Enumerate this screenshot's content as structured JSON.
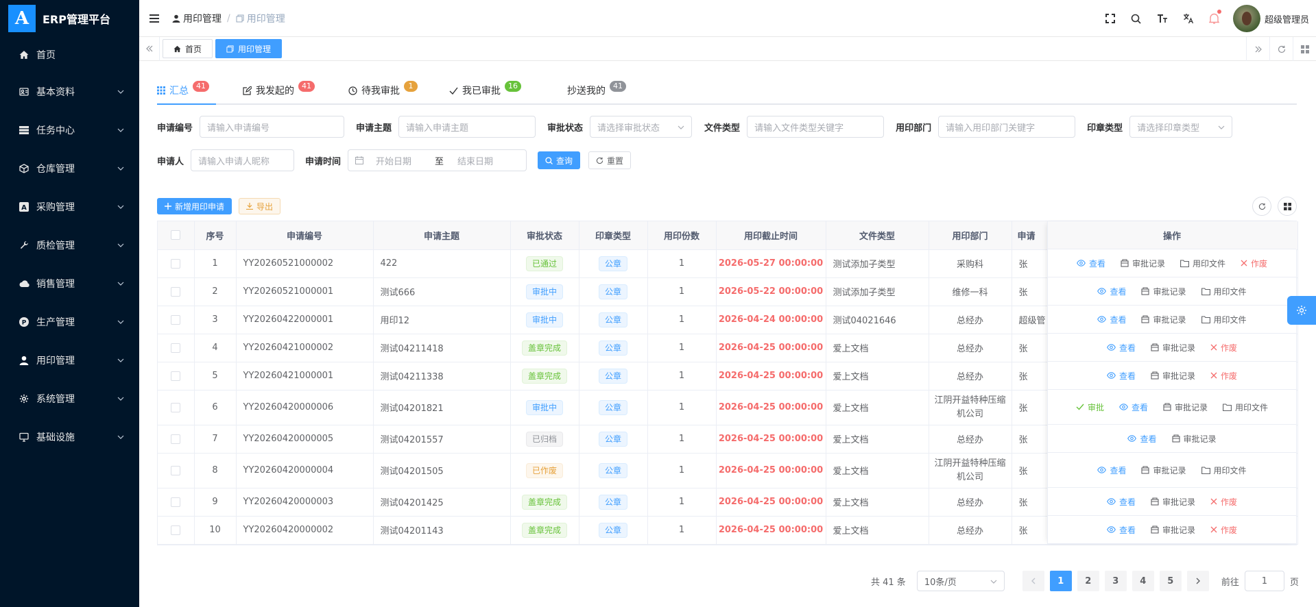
{
  "app": {
    "logo_letter": "A",
    "title": "ERP管理平台"
  },
  "sidebar": {
    "items": [
      {
        "label": "首页",
        "icon": "home-icon",
        "has_arrow": false
      },
      {
        "label": "基本资料",
        "icon": "profile-icon",
        "has_arrow": true
      },
      {
        "label": "任务中心",
        "icon": "server-icon",
        "has_arrow": true
      },
      {
        "label": "仓库管理",
        "icon": "box-icon",
        "has_arrow": true
      },
      {
        "label": "采购管理",
        "icon": "purchase-icon",
        "has_arrow": true
      },
      {
        "label": "质检管理",
        "icon": "tool-icon",
        "has_arrow": true
      },
      {
        "label": "销售管理",
        "icon": "cloud-icon",
        "has_arrow": true
      },
      {
        "label": "生产管理",
        "icon": "production-icon",
        "has_arrow": true
      },
      {
        "label": "用印管理",
        "icon": "stamp-icon",
        "has_arrow": true
      },
      {
        "label": "系统管理",
        "icon": "gear-icon",
        "has_arrow": true
      },
      {
        "label": "基础设施",
        "icon": "monitor-icon",
        "has_arrow": true
      }
    ]
  },
  "header": {
    "breadcrumb": [
      "用印管理",
      "用印管理"
    ],
    "user_name": "超级管理员"
  },
  "tags": {
    "items": [
      {
        "label": "首页",
        "active": false
      },
      {
        "label": "用印管理",
        "active": true
      }
    ]
  },
  "tabs": [
    {
      "label": "汇总",
      "count": "41",
      "badge": "red",
      "active": true
    },
    {
      "label": "我发起的",
      "count": "41",
      "badge": "red",
      "active": false
    },
    {
      "label": "待我审批",
      "count": "1",
      "badge": "orange",
      "active": false
    },
    {
      "label": "我已审批",
      "count": "16",
      "badge": "green",
      "active": false
    },
    {
      "label": "抄送我的",
      "count": "41",
      "badge": "gray",
      "active": false
    }
  ],
  "filters": {
    "apply_no": {
      "label": "申请编号",
      "placeholder": "请输入申请编号"
    },
    "subject": {
      "label": "申请主题",
      "placeholder": "请输入申请主题"
    },
    "approval_status": {
      "label": "审批状态",
      "placeholder": "请选择审批状态"
    },
    "doc_type": {
      "label": "文件类型",
      "placeholder": "请输入文件类型关键字"
    },
    "dept": {
      "label": "用印部门",
      "placeholder": "请输入用印部门关键字"
    },
    "seal_type": {
      "label": "印章类型",
      "placeholder": "请选择印章类型"
    },
    "applicant": {
      "label": "申请人",
      "placeholder": "请输入申请人昵称"
    },
    "apply_time": {
      "label": "申请时间",
      "start_placeholder": "开始日期",
      "separator": "至",
      "end_placeholder": "结束日期"
    },
    "search_label": "查询",
    "reset_label": "重置"
  },
  "toolbar": {
    "add_label": "新增用印申请",
    "export_label": "导出"
  },
  "table": {
    "columns": [
      "序号",
      "申请编号",
      "申请主题",
      "审批状态",
      "印章类型",
      "用印份数",
      "用印截止时间",
      "文件类型",
      "用印部门",
      "申请"
    ],
    "ops_header": "操作",
    "rows": [
      {
        "idx": "1",
        "no": "YY20260521000002",
        "subject": "422",
        "status": "已通过",
        "status_color": "green",
        "seal": "公章",
        "copies": "1",
        "deadline": "2026-05-27 00:00:00",
        "doc_type": "测试添加子类型",
        "dept": "采购科",
        "applicant": "张",
        "ops": [
          "查看",
          "审批记录",
          "用印文件",
          "作废"
        ]
      },
      {
        "idx": "2",
        "no": "YY20260521000001",
        "subject": "测试666",
        "status": "审批中",
        "status_color": "blue",
        "seal": "公章",
        "copies": "1",
        "deadline": "2026-05-22 00:00:00",
        "doc_type": "测试添加子类型",
        "dept": "维修一科",
        "applicant": "张",
        "ops": [
          "查看",
          "审批记录",
          "用印文件"
        ]
      },
      {
        "idx": "3",
        "no": "YY20260422000001",
        "subject": "用印12",
        "status": "审批中",
        "status_color": "blue",
        "seal": "公章",
        "copies": "1",
        "deadline": "2026-04-24 00:00:00",
        "doc_type": "测试04021646",
        "dept": "总经办",
        "applicant": "超级管",
        "ops": [
          "查看",
          "审批记录",
          "用印文件"
        ]
      },
      {
        "idx": "4",
        "no": "YY20260421000002",
        "subject": "测试04211418",
        "status": "盖章完成",
        "status_color": "green",
        "seal": "公章",
        "copies": "1",
        "deadline": "2026-04-25 00:00:00",
        "doc_type": "爱上文档",
        "dept": "总经办",
        "applicant": "张",
        "ops": [
          "查看",
          "审批记录",
          "作废"
        ]
      },
      {
        "idx": "5",
        "no": "YY20260421000001",
        "subject": "测试04211338",
        "status": "盖章完成",
        "status_color": "green",
        "seal": "公章",
        "copies": "1",
        "deadline": "2026-04-25 00:00:00",
        "doc_type": "爱上文档",
        "dept": "总经办",
        "applicant": "张",
        "ops": [
          "查看",
          "审批记录",
          "作废"
        ]
      },
      {
        "idx": "6",
        "no": "YY20260420000006",
        "subject": "测试04201821",
        "status": "审批中",
        "status_color": "blue",
        "seal": "公章",
        "copies": "1",
        "deadline": "2026-04-25 00:00:00",
        "doc_type": "爱上文档",
        "dept": "江阴开益特种压缩机公司",
        "applicant": "张",
        "ops": [
          "审批",
          "查看",
          "审批记录",
          "用印文件"
        ]
      },
      {
        "idx": "7",
        "no": "YY20260420000005",
        "subject": "测试04201557",
        "status": "已归档",
        "status_color": "gray",
        "seal": "公章",
        "copies": "1",
        "deadline": "2026-04-25 00:00:00",
        "doc_type": "爱上文档",
        "dept": "总经办",
        "applicant": "张",
        "ops": [
          "查看",
          "审批记录"
        ]
      },
      {
        "idx": "8",
        "no": "YY20260420000004",
        "subject": "测试04201505",
        "status": "已作废",
        "status_color": "orange",
        "seal": "公章",
        "copies": "1",
        "deadline": "2026-04-25 00:00:00",
        "doc_type": "爱上文档",
        "dept": "江阴开益特种压缩机公司",
        "applicant": "张",
        "ops": [
          "查看",
          "审批记录",
          "用印文件"
        ]
      },
      {
        "idx": "9",
        "no": "YY20260420000003",
        "subject": "测试04201425",
        "status": "盖章完成",
        "status_color": "green",
        "seal": "公章",
        "copies": "1",
        "deadline": "2026-04-25 00:00:00",
        "doc_type": "爱上文档",
        "dept": "总经办",
        "applicant": "张",
        "ops": [
          "查看",
          "审批记录",
          "作废"
        ]
      },
      {
        "idx": "10",
        "no": "YY20260420000002",
        "subject": "测试04201143",
        "status": "盖章完成",
        "status_color": "green",
        "seal": "公章",
        "copies": "1",
        "deadline": "2026-04-25 00:00:00",
        "doc_type": "爱上文档",
        "dept": "总经办",
        "applicant": "张",
        "ops": [
          "查看",
          "审批记录",
          "作废"
        ]
      }
    ]
  },
  "pagination": {
    "total_label": "共 41 条",
    "page_size": "10条/页",
    "pages": [
      "1",
      "2",
      "3",
      "4",
      "5"
    ],
    "current": "1",
    "goto_label": "前往",
    "goto_value": "1",
    "page_suffix": "页"
  },
  "colors": {
    "sidebar_bg": "#001529",
    "primary": "#409eff",
    "danger": "#f56c6c",
    "success": "#67c23a",
    "warning": "#e6a23c"
  }
}
